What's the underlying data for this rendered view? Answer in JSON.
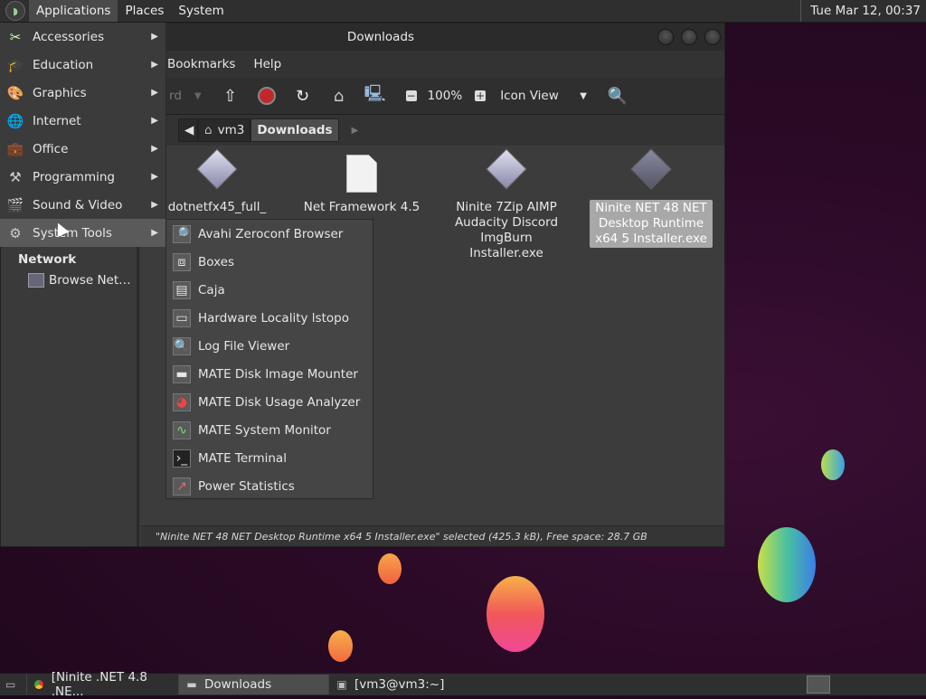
{
  "top_panel": {
    "menus": [
      "Applications",
      "Places",
      "System"
    ],
    "clock": "Tue Mar 12, 00:37"
  },
  "window": {
    "title": "Downloads",
    "menubar": [
      "Bookmarks",
      "Help"
    ],
    "toolbar": {
      "back_label": "rd",
      "zoom": "100%",
      "view_mode": "Icon View"
    },
    "location": [
      "vm3",
      "Downloads"
    ],
    "files": [
      {
        "name": "dotnetfx45_full_",
        "icon": "installer-icon"
      },
      {
        "name": "Net Framework 4.5",
        "icon": "document-icon"
      },
      {
        "name": "Ninite 7Zip AIMP Audacity Discord ImgBurn Installer.exe",
        "icon": "installer-icon"
      },
      {
        "name": "Ninite NET 48 NET Desktop Runtime x64 5 Installer.exe",
        "icon": "installer-icon",
        "selected": true
      }
    ],
    "status": "\"Ninite NET 48 NET Desktop Runtime x64 5 Installer.exe\" selected (425.3 kB), Free space: 28.7 GB",
    "sidebar": {
      "section": "Network",
      "items": [
        "Browse Net…"
      ]
    }
  },
  "apps_menu": {
    "items": [
      {
        "label": "Accessories",
        "icon": "accessories-icon"
      },
      {
        "label": "Education",
        "icon": "education-icon"
      },
      {
        "label": "Graphics",
        "icon": "graphics-icon"
      },
      {
        "label": "Internet",
        "icon": "internet-icon"
      },
      {
        "label": "Office",
        "icon": "office-icon"
      },
      {
        "label": "Programming",
        "icon": "programming-icon"
      },
      {
        "label": "Sound & Video",
        "icon": "sound-video-icon"
      },
      {
        "label": "System Tools",
        "icon": "system-tools-icon",
        "hover": true
      }
    ]
  },
  "system_tools_menu": {
    "items": [
      {
        "label": "Avahi Zeroconf Browser",
        "icon": "avahi-icon"
      },
      {
        "label": "Boxes",
        "icon": "boxes-icon"
      },
      {
        "label": "Caja",
        "icon": "caja-icon"
      },
      {
        "label": "Hardware Locality lstopo",
        "icon": "hardware-icon"
      },
      {
        "label": "Log File Viewer",
        "icon": "log-viewer-icon"
      },
      {
        "label": "MATE Disk Image Mounter",
        "icon": "disk-mounter-icon"
      },
      {
        "label": "MATE Disk Usage Analyzer",
        "icon": "disk-usage-icon"
      },
      {
        "label": "MATE System Monitor",
        "icon": "system-monitor-icon"
      },
      {
        "label": "MATE Terminal",
        "icon": "terminal-icon"
      },
      {
        "label": "Power Statistics",
        "icon": "power-stats-icon"
      }
    ]
  },
  "taskbar": {
    "tasks": [
      {
        "label": "[Ninite .NET 4.8 .NE...",
        "icon": "chrome-icon"
      },
      {
        "label": "Downloads",
        "icon": "folder-icon",
        "active": true
      },
      {
        "label": "[vm3@vm3:~]",
        "icon": "terminal-icon"
      }
    ]
  },
  "colors": {
    "panel_bg": "#2f2f2f",
    "window_bg": "#3a3a3a",
    "desktop_bg": "#2a0a26"
  }
}
